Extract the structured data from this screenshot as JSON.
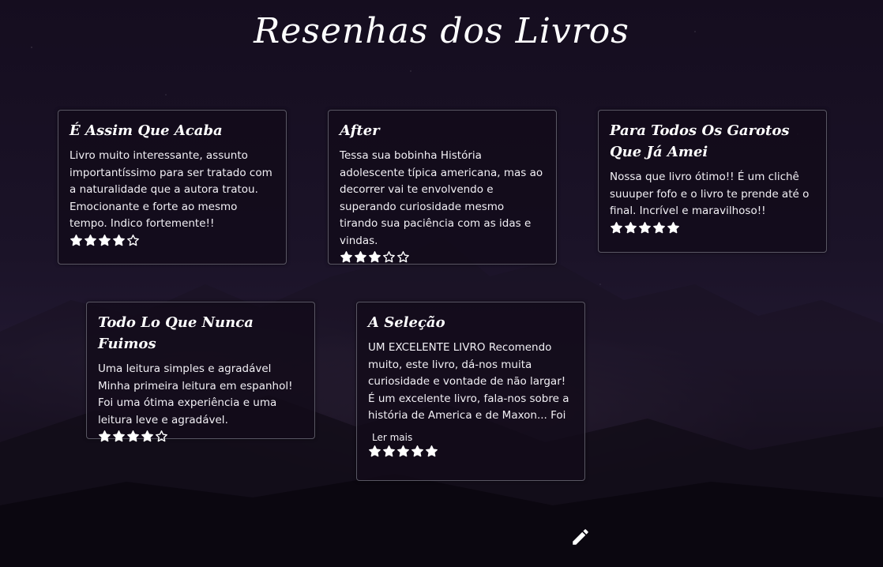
{
  "page": {
    "title": "Resenhas dos Livros"
  },
  "reviews": [
    {
      "title": "É Assim Que Acaba",
      "text": " Livro muito interessante, assunto importantíssimo para ser tratado com a naturalidade que a autora tratou. Emocionante e forte ao mesmo tempo. Indico fortemente!!",
      "rating": 4,
      "max_rating": 5
    },
    {
      "title": "After",
      "text": "Tessa sua bobinha História adolescente típica americana, mas ao decorrer vai te envolvendo e superando curiosidade mesmo tirando sua paciência com as idas e vindas.",
      "rating": 3,
      "max_rating": 5
    },
    {
      "title": "Para Todos Os Garotos Que Já Amei",
      "text": " Nossa que livro ótimo!! É um clichê suuuper fofo e o livro te prende até o final. Incrível e maravilhoso!!",
      "rating": 5,
      "max_rating": 5
    },
    {
      "title": "Todo Lo Que Nunca Fuimos",
      "text": "Uma leitura simples e agradável Minha primeira leitura em espanhol! Foi uma ótima experiência e uma leitura leve e agradável.",
      "rating": 4,
      "max_rating": 5
    },
    {
      "title": "A Seleção",
      "text": "UM EXCELENTE LIVRO Recomendo muito, este livro, dá-nos muita curiosidade e vontade de não largar! É um excelente livro, fala-nos sobre a história de America e de Maxon... Foi a",
      "read_more": "Ler mais",
      "rating": 5,
      "max_rating": 5
    }
  ],
  "actions": {
    "edit_icon": "pencil-icon"
  },
  "colors": {
    "star": "#ffffff",
    "card_border": "#96969f",
    "card_bg": "#120b1a"
  }
}
